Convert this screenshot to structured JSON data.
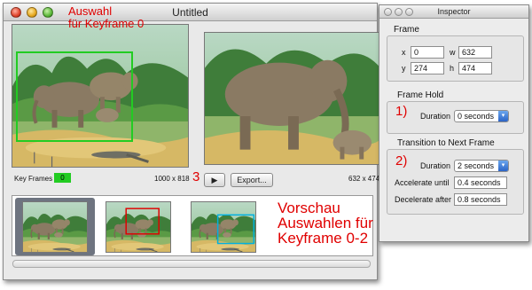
{
  "main_window": {
    "title": "Untitled",
    "key_frames_label": "Key Frames",
    "key_frames_count": "0",
    "left_dims": "1000 x 818",
    "right_dims": "632 x 474",
    "play_label": "▶",
    "export_label": "Export..."
  },
  "annotations": {
    "selection_l1": "Auswahl",
    "selection_l2": "für Keyframe 0",
    "number_three": "3",
    "preview_l1": "Vorschau",
    "preview_l2": "Auswahlen für",
    "preview_l3": "Keyframe 0-2",
    "one": "1)",
    "two": "2)"
  },
  "inspector": {
    "title": "Inspector",
    "frame": {
      "title": "Frame",
      "x_label": "x",
      "x": "0",
      "w_label": "w",
      "w": "632",
      "y_label": "y",
      "y": "274",
      "h_label": "h",
      "h": "474"
    },
    "frame_hold": {
      "title": "Frame Hold",
      "duration_label": "Duration",
      "duration_value": "0 seconds"
    },
    "transition": {
      "title": "Transition to Next Frame",
      "duration_label": "Duration",
      "duration_value": "2 seconds",
      "accelerate_label": "Accelerate until",
      "accelerate_value": "0.4 seconds",
      "decelerate_label": "Decelerate after",
      "decelerate_value": "0.8 seconds"
    }
  },
  "colors": {
    "annotation": "#e00000",
    "selection_rect": "#22cc22",
    "popup_accent": "#2b64c6"
  }
}
